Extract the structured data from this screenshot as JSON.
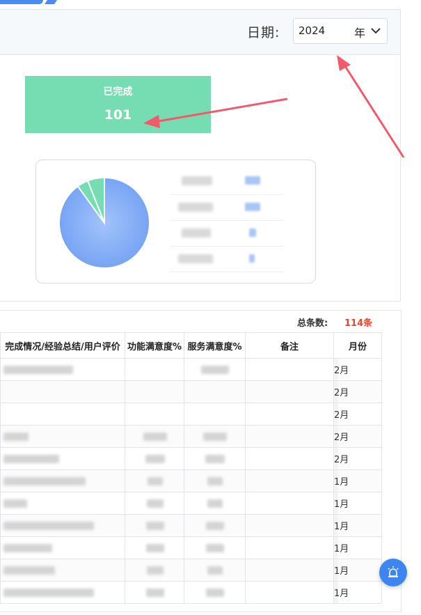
{
  "header": {
    "date_label": "日期:",
    "year_value": "2024",
    "year_unit": "年"
  },
  "summary": {
    "completed_label": "已完成",
    "completed_count": "101"
  },
  "pie": {
    "slices": [
      {
        "value": 90,
        "color": "#7ea9f6"
      },
      {
        "value": 4,
        "color": "#76dcb2"
      },
      {
        "value": 6,
        "color": "#76dcb2"
      }
    ]
  },
  "table": {
    "total_label": "总条数:",
    "total_value": "114条",
    "columns": [
      "完成情况/经验总结/用户评价",
      "功能满意度%",
      "服务满意度%",
      "备注",
      "月份"
    ],
    "rows": [
      {
        "month": "2月"
      },
      {
        "month": "2月"
      },
      {
        "month": "2月"
      },
      {
        "month": "2月"
      },
      {
        "month": "2月"
      },
      {
        "month": "1月"
      },
      {
        "month": "1月"
      },
      {
        "month": "1月"
      },
      {
        "month": "1月"
      },
      {
        "month": "1月"
      },
      {
        "month": "1月"
      }
    ]
  },
  "colors": {
    "accent": "#3d86f2",
    "stat_green": "#76dcb2",
    "total_red": "#e4472f",
    "arrow": "#f05a6a"
  },
  "icons": {
    "dropdown": "chevron-down-icon",
    "fab": "alarm-icon"
  }
}
